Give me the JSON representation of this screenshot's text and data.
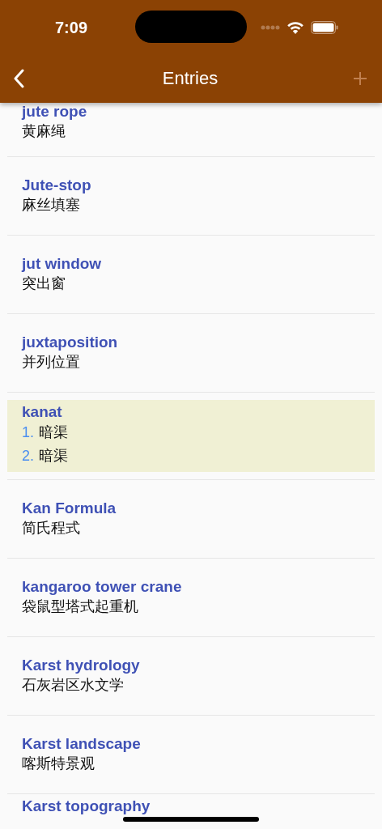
{
  "status_bar": {
    "time": "7:09"
  },
  "nav_bar": {
    "title": "Entries",
    "back_enabled": true,
    "add_enabled": false
  },
  "entries": [
    {
      "term": "jute rope",
      "selected": false,
      "senses": [
        {
          "text": "黄麻绳"
        }
      ]
    },
    {
      "term": "Jute-stop",
      "selected": false,
      "senses": [
        {
          "text": "麻丝填塞"
        }
      ]
    },
    {
      "term": "jut window",
      "selected": false,
      "senses": [
        {
          "text": "突出窗"
        }
      ]
    },
    {
      "term": "juxtaposition",
      "selected": false,
      "senses": [
        {
          "text": "并列位置"
        }
      ]
    },
    {
      "term": "kanat",
      "selected": true,
      "senses": [
        {
          "number": "1.",
          "text": "暗渠"
        },
        {
          "number": "2.",
          "text": "暗渠"
        }
      ]
    },
    {
      "term": "Kan Formula",
      "selected": false,
      "senses": [
        {
          "text": "简氏程式"
        }
      ]
    },
    {
      "term": "kangaroo tower crane",
      "selected": false,
      "senses": [
        {
          "text": "袋鼠型塔式起重机"
        }
      ]
    },
    {
      "term": "Karst hydrology",
      "selected": false,
      "senses": [
        {
          "text": "石灰岩区水文学"
        }
      ]
    },
    {
      "term": "Karst landscape",
      "selected": false,
      "senses": [
        {
          "text": "喀斯特景观"
        }
      ]
    },
    {
      "term": "Karst topography",
      "selected": false
    }
  ]
}
